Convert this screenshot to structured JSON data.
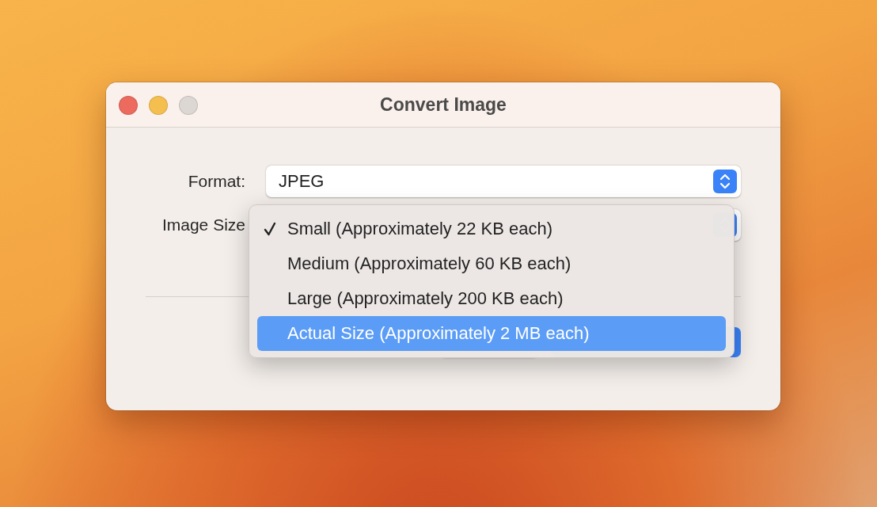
{
  "window": {
    "title": "Convert Image"
  },
  "fields": [
    {
      "label": "Format:",
      "value": "JPEG"
    },
    {
      "label": "Image Size"
    }
  ],
  "menu": {
    "items": [
      {
        "label": "Small (Approximately 22 KB each)",
        "checked": true,
        "highlighted": false
      },
      {
        "label": "Medium (Approximately 60 KB each)",
        "checked": false,
        "highlighted": false
      },
      {
        "label": "Large (Approximately 200 KB each)",
        "checked": false,
        "highlighted": false
      },
      {
        "label": "Actual Size (Approximately 2 MB each)",
        "checked": false,
        "highlighted": true
      }
    ]
  }
}
